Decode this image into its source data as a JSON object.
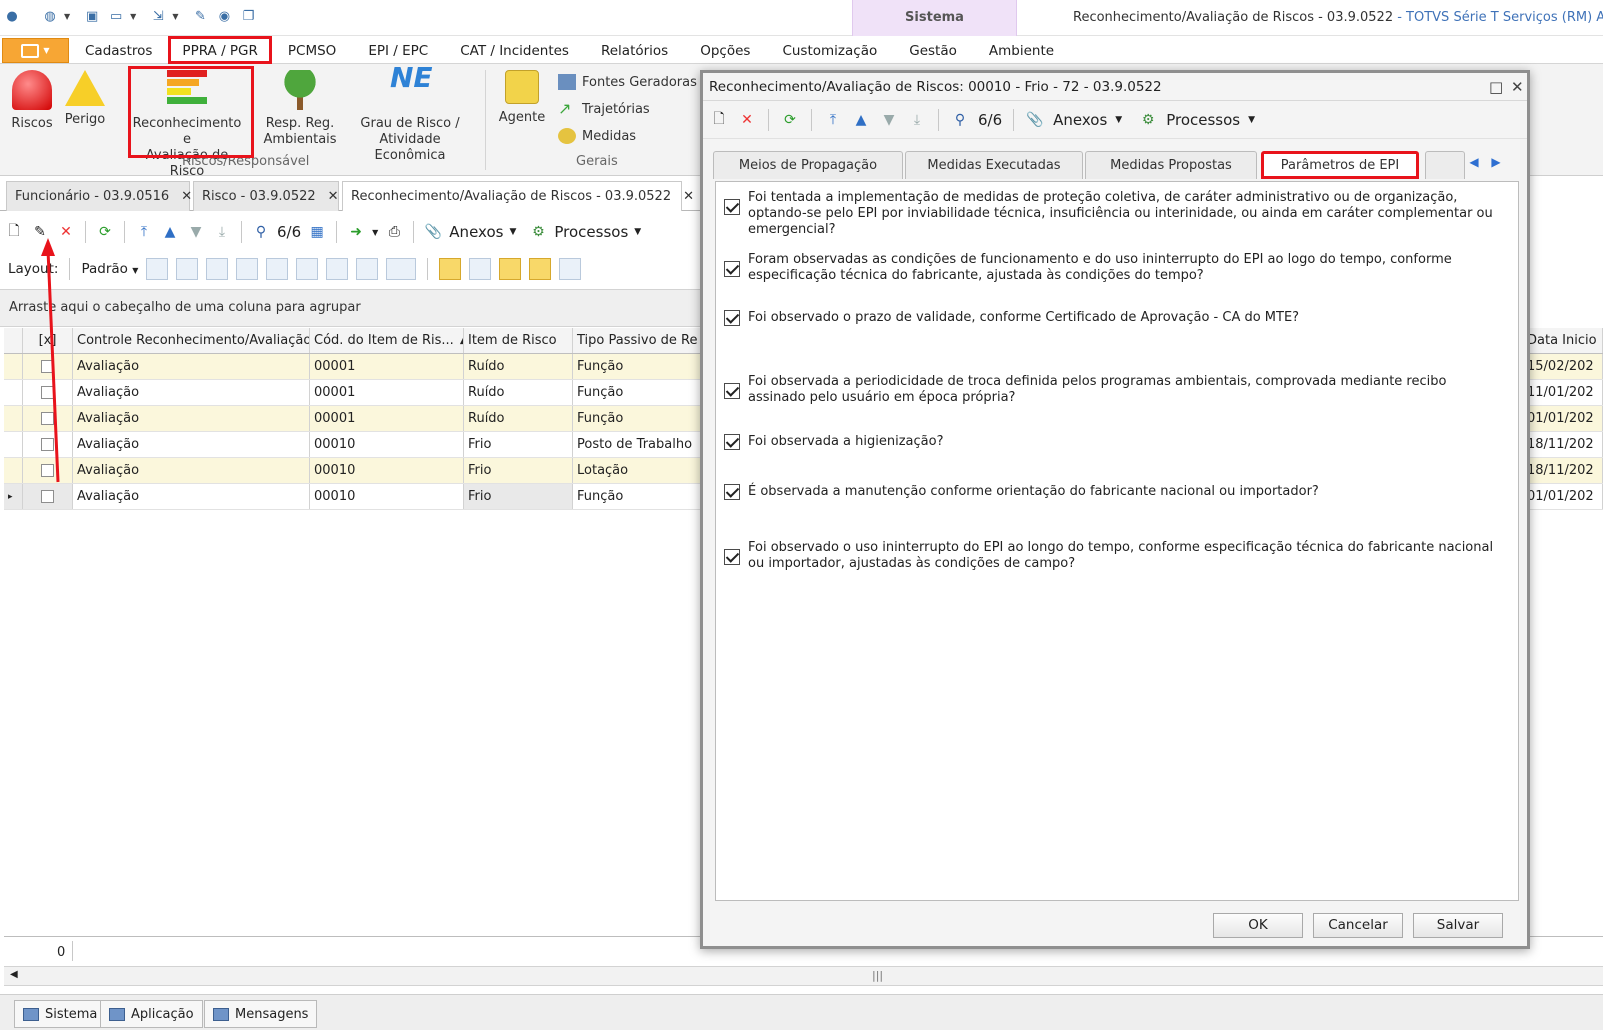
{
  "window": {
    "title": "Reconhecimento/Avaliação de Riscos - 03.9.0522",
    "subtitle": " - TOTVS Série T Serviços (RM) Alias: C",
    "context_tab": "Sistema"
  },
  "menu": {
    "tabs": [
      "Cadastros",
      "PPRA / PGR",
      "PCMSO",
      "EPI / EPC",
      "CAT / Incidentes",
      "Relatórios",
      "Opções",
      "Customização",
      "Gestão",
      "Ambiente"
    ]
  },
  "ribbon": {
    "riscos": "Riscos",
    "perigo": "Perigo",
    "reconhecimento_l1": "Reconhecimento e",
    "reconhecimento_l2": "Avaliação de Risco",
    "resp_l1": "Resp. Reg.",
    "resp_l2": "Ambientais",
    "grau_l1": "Grau de Risco /",
    "grau_l2": "Atividade Econômica",
    "group1_label": "Riscos/Responsável",
    "agente": "Agente",
    "fontes": "Fontes Geradoras",
    "trajetorias": "Trajetórias",
    "medidas": "Medidas",
    "group2_label": "Gerais"
  },
  "doc_tabs": [
    "Funcionário - 03.9.0516",
    "Risco - 03.9.0522",
    "Reconhecimento/Avaliação de Riscos - 03.9.0522"
  ],
  "toolbar": {
    "counter": "6/6",
    "anexos": "Anexos",
    "processos": "Processos",
    "layout_label": "Layout:",
    "layout_value": "Padrão"
  },
  "group_panel_text": "Arraste aqui o cabeçalho de uma coluna para agrupar",
  "grid": {
    "columns": [
      "[x]",
      "Controle Reconhecimento/Avaliação",
      "Cód. do Item de Ris...",
      "Item de Risco",
      "Tipo Passivo de Re",
      "Data Inicio"
    ],
    "rows": [
      {
        "controle": "Avaliação",
        "cod": "00001",
        "item": "Ruído",
        "tipo": "Função",
        "data": "15/02/202"
      },
      {
        "controle": "Avaliação",
        "cod": "00001",
        "item": "Ruído",
        "tipo": "Função",
        "data": "11/01/202"
      },
      {
        "controle": "Avaliação",
        "cod": "00001",
        "item": "Ruído",
        "tipo": "Função",
        "data": "01/01/202"
      },
      {
        "controle": "Avaliação",
        "cod": "00010",
        "item": "Frio",
        "tipo": "Posto de Trabalho",
        "data": "18/11/202"
      },
      {
        "controle": "Avaliação",
        "cod": "00010",
        "item": "Frio",
        "tipo": "Lotação",
        "data": "18/11/202"
      },
      {
        "controle": "Avaliação",
        "cod": "00010",
        "item": "Frio",
        "tipo": "Função",
        "data": "01/01/202"
      }
    ],
    "footer_count": "0"
  },
  "statusbar": [
    "Sistema",
    "Aplicação",
    "Mensagens"
  ],
  "dialog": {
    "title": "Reconhecimento/Avaliação de Riscos: 00010 - Frio - 72 - 03.9.0522",
    "counter": "6/6",
    "anexos": "Anexos",
    "processos": "Processos",
    "tabs": [
      "Meios de Propagação",
      "Medidas Executadas",
      "Medidas Propostas",
      "Parâmetros de EPI"
    ],
    "questions": [
      "Foi tentada a implementação de medidas de proteção coletiva, de caráter administrativo ou de organização, optando-se pelo EPI por inviabilidade técnica, insuficiência ou interinidade, ou ainda em caráter complementar ou emergencial?",
      "Foram observadas as condições de funcionamento e do uso ininterrupto do EPI ao logo do tempo, conforme especificação técnica do fabricante, ajustada às condições do tempo?",
      "Foi observado o prazo de validade, conforme Certificado de Aprovação - CA do MTE?",
      "Foi observada a periodicidade de troca definida pelos programas ambientais, comprovada mediante recibo assinado pelo usuário em época própria?",
      "Foi observada a higienização?",
      "É observada a manutenção conforme orientação do fabricante nacional ou importador?",
      "Foi observado o uso ininterrupto do EPI ao longo do tempo, conforme especificação técnica do fabricante nacional ou importador, ajustadas às condições de campo?"
    ],
    "buttons": {
      "ok": "OK",
      "cancel": "Cancelar",
      "save": "Salvar"
    }
  }
}
